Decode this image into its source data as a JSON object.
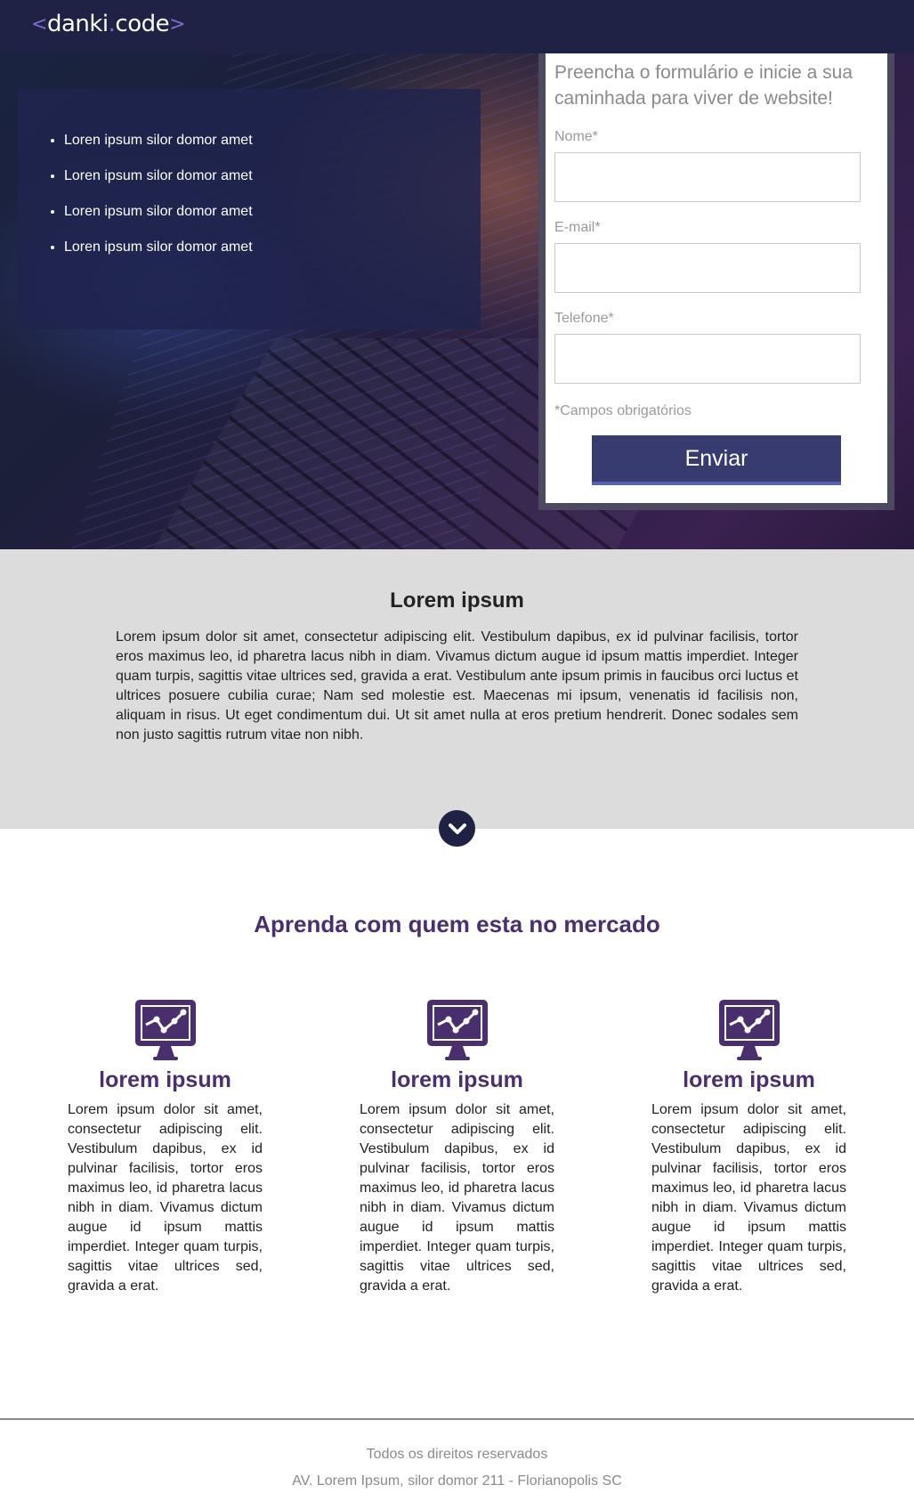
{
  "header": {
    "logo_open": "<",
    "logo_name_1": "danki",
    "logo_dot": ".",
    "logo_name_2": "code",
    "logo_close": ">"
  },
  "hero": {
    "features": [
      "Loren ipsum silor domor amet",
      "Loren ipsum silor domor amet",
      "Loren ipsum silor domor amet",
      "Loren ipsum silor domor amet"
    ]
  },
  "form": {
    "title": "Preencha o formulário e inicie a sua caminhada para viver de website!",
    "name_label": "Nome*",
    "email_label": "E-mail*",
    "phone_label": "Telefone*",
    "required_note": "*Campos obrigatórios",
    "submit_label": "Enviar"
  },
  "about": {
    "title": "Lorem ipsum",
    "text": "Lorem ipsum dolor sit amet, consectetur adipiscing elit. Vestibulum dapibus, ex id pulvinar facilisis, tortor eros maximus leo, id pharetra lacus nibh in diam. Vivamus dictum augue id ipsum mattis imperdiet. Integer quam turpis, sagittis vitae ultrices sed, gravida a erat. Vestibulum ante ipsum primis in faucibus orci luctus et ultrices posuere cubilia curae; Nam sed molestie est. Maecenas mi ipsum, venenatis id facilisis non, aliquam in risus. Ut eget condimentum dui. Ut sit amet nulla at eros pretium hendrerit. Donec sodales sem non justo sagittis rutrum vitae non nibh."
  },
  "market": {
    "title": "Aprenda com quem esta no mercado",
    "cards": [
      {
        "icon": "monitor-chart-icon",
        "title": "lorem ipsum",
        "text": "Lorem ipsum dolor sit amet, consectetur adipiscing elit. Vestibulum dapibus, ex id pulvinar facilisis, tortor eros maximus leo, id pharetra lacus nibh in diam. Vivamus dictum augue id ipsum mattis imperdiet. Integer quam turpis, sagittis vitae ultrices sed, gravida a erat."
      },
      {
        "icon": "monitor-chart-icon",
        "title": "lorem ipsum",
        "text": "Lorem ipsum dolor sit amet, consectetur adipiscing elit. Vestibulum dapibus, ex id pulvinar facilisis, tortor eros maximus leo, id pharetra lacus nibh in diam. Vivamus dictum augue id ipsum mattis imperdiet. Integer quam turpis, sagittis vitae ultrices sed, gravida a erat."
      },
      {
        "icon": "monitor-chart-icon",
        "title": "lorem ipsum",
        "text": "Lorem ipsum dolor sit amet, consectetur adipiscing elit. Vestibulum dapibus, ex id pulvinar facilisis, tortor eros maximus leo, id pharetra lacus nibh in diam. Vivamus dictum augue id ipsum mattis imperdiet. Integer quam turpis, sagittis vitae ultrices sed, gravida a erat."
      }
    ]
  },
  "footer": {
    "rights": "Todos os direitos reservados",
    "address": "AV. Lorem Ipsum, silor domor 211 - Florianopolis SC"
  },
  "colors": {
    "header_bg": "#1f2245",
    "accent_purple": "#4a2f6e",
    "button_bg": "#383b70",
    "about_bg": "#dcdcdc"
  }
}
